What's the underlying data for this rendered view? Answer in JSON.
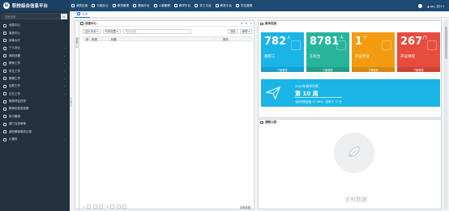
{
  "app": {
    "logo": "科",
    "title": "职校综合信息平台"
  },
  "topnav": [
    {
      "label": "我的应用"
    },
    {
      "label": "行政办公"
    },
    {
      "label": "教务管理"
    },
    {
      "label": "基础平台"
    },
    {
      "label": "人事管理"
    },
    {
      "label": "教学平台"
    },
    {
      "label": "学工平台"
    },
    {
      "label": "教务平台"
    },
    {
      "label": "学生缴费"
    }
  ],
  "user": {
    "menu": "▲ qq | 设计 ▾",
    "settings": "设计 ▾"
  },
  "sidebar": {
    "search_placeholder": "搜索菜单",
    "items": [
      {
        "label": "消息中心",
        "chev": ""
      },
      {
        "label": "事务中心",
        "chev": ""
      },
      {
        "label": "待事大厅",
        "chev": ""
      },
      {
        "label": "个人办公",
        "chev": "⌄"
      },
      {
        "label": "我的设置",
        "chev": "⌄"
      },
      {
        "label": "教师工作",
        "chev": "⌄"
      },
      {
        "label": "学生工作",
        "chev": "⌄"
      },
      {
        "label": "教辅工作",
        "chev": "⌄"
      },
      {
        "label": "后勤工作",
        "chev": "⌄"
      },
      {
        "label": "企业工作",
        "chev": "⌄"
      },
      {
        "label": "教师评估任务",
        "chev": ""
      },
      {
        "label": "教师实验室查看",
        "chev": ""
      },
      {
        "label": "练习教师",
        "chev": ""
      },
      {
        "label": "部门业务审核",
        "chev": ""
      },
      {
        "label": "我的教师事件记录",
        "chev": ""
      },
      {
        "label": "小插件",
        "chev": "⌄"
      }
    ]
  },
  "tabs": {
    "home": "主页"
  },
  "message_center": {
    "side_label": "消息中心",
    "title": "消息中心",
    "tools": [
      "⚙",
      "↻",
      "✕"
    ],
    "toolbar": {
      "status": "显示未读 ▾",
      "time": "时间范围 ▾",
      "search_placeholder": "搜索标题",
      "search_btn": "搜索",
      "tool_btn": "管理 ▾"
    },
    "columns": [
      "来源",
      "标题",
      "操作"
    ],
    "pager": {
      "page": "/ 0",
      "info": "没有数据"
    }
  },
  "basic_info": {
    "title": "基本信息",
    "stats": [
      {
        "num": "782",
        "unit": "人",
        "label": "教职工",
        "more": "了解更多",
        "color": "#1ab5e6"
      },
      {
        "num": "8781",
        "unit": "人",
        "label": "在校生",
        "more": "了解更多",
        "color": "#26b59a"
      },
      {
        "num": "1",
        "unit": "个",
        "label": "开设专业",
        "more": "了解更多",
        "color": "#f39c12"
      },
      {
        "num": "267",
        "unit": "门",
        "label": "开设课程",
        "more": "了解更多",
        "color": "#e74c3c"
      }
    ],
    "term": {
      "year": "2020年春季学期",
      "week": "第 10 周",
      "progress": "当前学期进度 47.00%，还剩下 72 天"
    }
  },
  "notice": {
    "title": "通知公告",
    "empty": "没有数据"
  }
}
